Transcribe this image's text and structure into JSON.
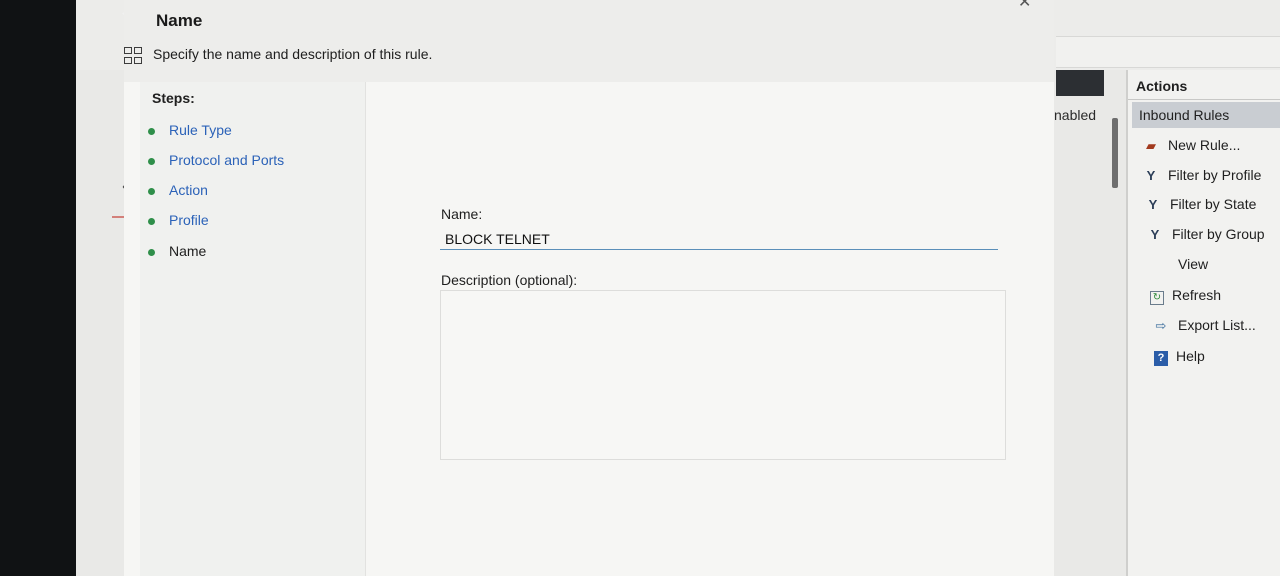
{
  "wizard": {
    "title": "Name",
    "subtitle": "Specify the name and description of this rule.",
    "steps_title": "Steps:",
    "steps": [
      {
        "label": "Rule Type",
        "state": "link"
      },
      {
        "label": "Protocol and Ports",
        "state": "link"
      },
      {
        "label": "Action",
        "state": "link"
      },
      {
        "label": "Profile",
        "state": "link"
      },
      {
        "label": "Name",
        "state": "current"
      }
    ],
    "name_label": "Name:",
    "name_value": "BLOCK TELNET",
    "description_label": "Description (optional):",
    "description_value": ""
  },
  "background": {
    "column_fragment": "nabled"
  },
  "actions": {
    "header": "Actions",
    "group": "Inbound Rules",
    "items": [
      {
        "label": "New Rule...",
        "icon": "new-rule-icon"
      },
      {
        "label": "Filter by Profile",
        "icon": "filter-icon"
      },
      {
        "label": "Filter by State",
        "icon": "filter-icon"
      },
      {
        "label": "Filter by Group",
        "icon": "filter-icon"
      },
      {
        "label": "View",
        "icon": ""
      },
      {
        "label": "Refresh",
        "icon": "refresh-icon"
      },
      {
        "label": "Export List...",
        "icon": "export-icon"
      },
      {
        "label": "Help",
        "icon": "help-icon"
      }
    ]
  },
  "colors": {
    "link": "#2b62b8",
    "step_dot": "#2f8f4a",
    "input_underline": "#5b8fb9",
    "actions_group_bg": "#c9cdd2"
  }
}
